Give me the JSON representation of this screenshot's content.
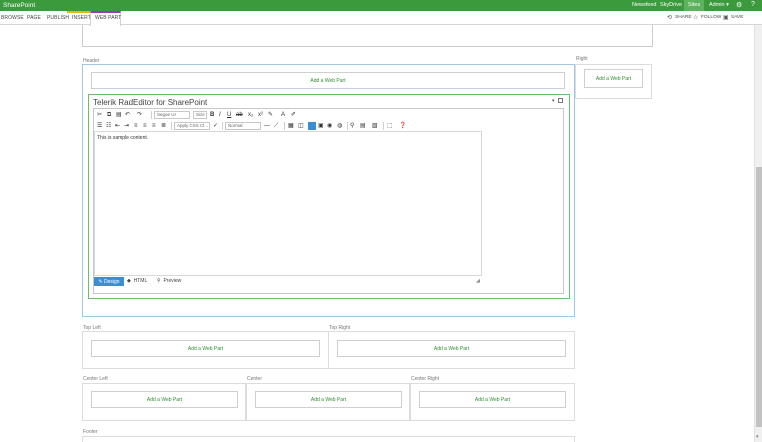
{
  "suite_bar": {
    "brand": "SharePoint",
    "links": [
      "Newsfeed",
      "SkyDrive",
      "Sites"
    ],
    "user": "Admin ▾",
    "colors": {
      "bar": "#3b9a3b",
      "selected": "#5db35d"
    },
    "icons": [
      "gear-icon",
      "help-icon"
    ]
  },
  "ribbon": {
    "tabs": [
      "BROWSE",
      "PAGE",
      "PUBLISH",
      "INSERT",
      "WEB PART"
    ],
    "actions": [
      "SHARE",
      "FOLLOW",
      "SAVE"
    ],
    "colors": {
      "insert": "#e8b700",
      "web_part": "#9b3bb4"
    }
  },
  "zones": {
    "header_label": "Header",
    "right_label": "Right",
    "top_left_label": "Top Left",
    "top_right_label": "Top Right",
    "center_left_label": "Center Left",
    "center_label": "Center",
    "center_right_label": "Center Right",
    "footer_label": "Footer",
    "add_web_part": "Add a Web Part"
  },
  "web_part": {
    "title": "Telerik RadEditor for SharePoint",
    "menu_glyph": "▾",
    "toolbar": {
      "font_name": "Segoe UI",
      "font_size": "Size",
      "css_class": "Apply CSS Cl...",
      "paragraph": "Normal"
    },
    "content": "This is sample content.",
    "modes": {
      "design": "Design",
      "html": "HTML",
      "preview": "Preview"
    }
  }
}
